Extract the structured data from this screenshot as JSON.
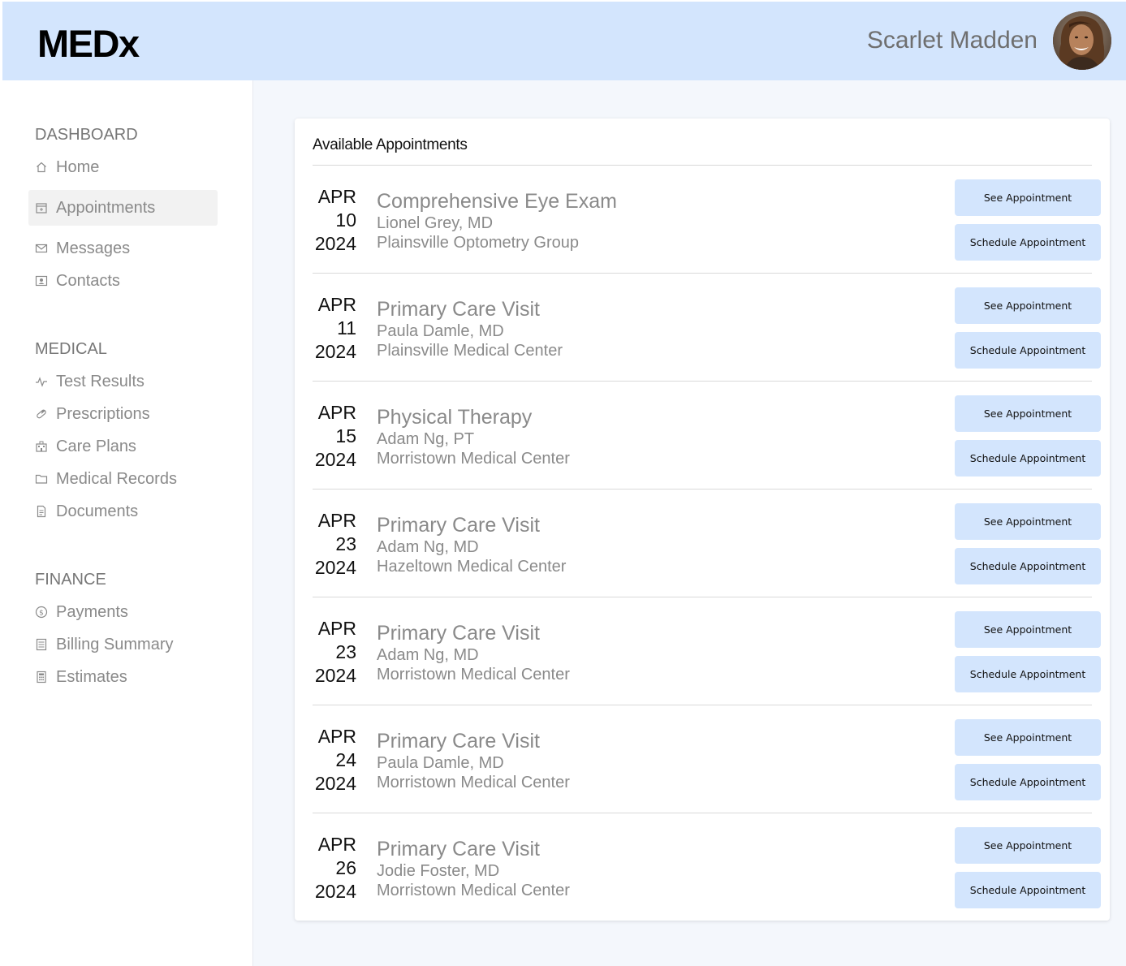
{
  "header": {
    "logo": "MEDx",
    "user_name": "Scarlet Madden",
    "avatar_icon": "user-avatar-photo",
    "background_color": "#d3e5fd"
  },
  "sidebar": {
    "sections": [
      {
        "title": "DASHBOARD",
        "items": [
          {
            "label": "Home",
            "icon": "home-icon",
            "active": false
          },
          {
            "label": "Appointments",
            "icon": "calendar-icon",
            "active": true
          },
          {
            "label": "Messages",
            "icon": "envelope-icon",
            "active": false
          },
          {
            "label": "Contacts",
            "icon": "contact-card-icon",
            "active": false
          }
        ]
      },
      {
        "title": "MEDICAL",
        "items": [
          {
            "label": "Test Results",
            "icon": "pulse-icon",
            "active": false
          },
          {
            "label": "Prescriptions",
            "icon": "pill-icon",
            "active": false
          },
          {
            "label": "Care Plans",
            "icon": "hospital-icon",
            "active": false
          },
          {
            "label": "Medical Records",
            "icon": "folder-icon",
            "active": false
          },
          {
            "label": "Documents",
            "icon": "document-icon",
            "active": false
          }
        ]
      },
      {
        "title": "FINANCE",
        "items": [
          {
            "label": "Payments",
            "icon": "dollar-coin-icon",
            "active": false
          },
          {
            "label": "Billing Summary",
            "icon": "receipt-icon",
            "active": false
          },
          {
            "label": "Estimates",
            "icon": "calculator-icon",
            "active": false
          }
        ]
      }
    ]
  },
  "main": {
    "card_title": "Available Appointments",
    "see_label": "See Appointment",
    "schedule_label": "Schedule Appointment",
    "appointments": [
      {
        "month": "APR",
        "day": "10",
        "year": "2024",
        "title": "Comprehensive Eye Exam",
        "doctor": "Lionel Grey, MD",
        "location": "Plainsville Optometry Group"
      },
      {
        "month": "APR",
        "day": "11",
        "year": "2024",
        "title": "Primary Care Visit",
        "doctor": "Paula Damle, MD",
        "location": "Plainsville Medical Center"
      },
      {
        "month": "APR",
        "day": "15",
        "year": "2024",
        "title": "Physical Therapy",
        "doctor": "Adam Ng, PT",
        "location": "Morristown Medical Center"
      },
      {
        "month": "APR",
        "day": "23",
        "year": "2024",
        "title": "Primary Care Visit",
        "doctor": "Adam Ng, MD",
        "location": "Hazeltown Medical Center"
      },
      {
        "month": "APR",
        "day": "23",
        "year": "2024",
        "title": "Primary Care Visit",
        "doctor": "Adam Ng, MD",
        "location": "Morristown Medical Center"
      },
      {
        "month": "APR",
        "day": "24",
        "year": "2024",
        "title": "Primary Care Visit",
        "doctor": "Paula Damle, MD",
        "location": "Morristown Medical Center"
      },
      {
        "month": "APR",
        "day": "26",
        "year": "2024",
        "title": "Primary Care Visit",
        "doctor": "Jodie Foster, MD",
        "location": "Morristown Medical Center"
      }
    ]
  }
}
